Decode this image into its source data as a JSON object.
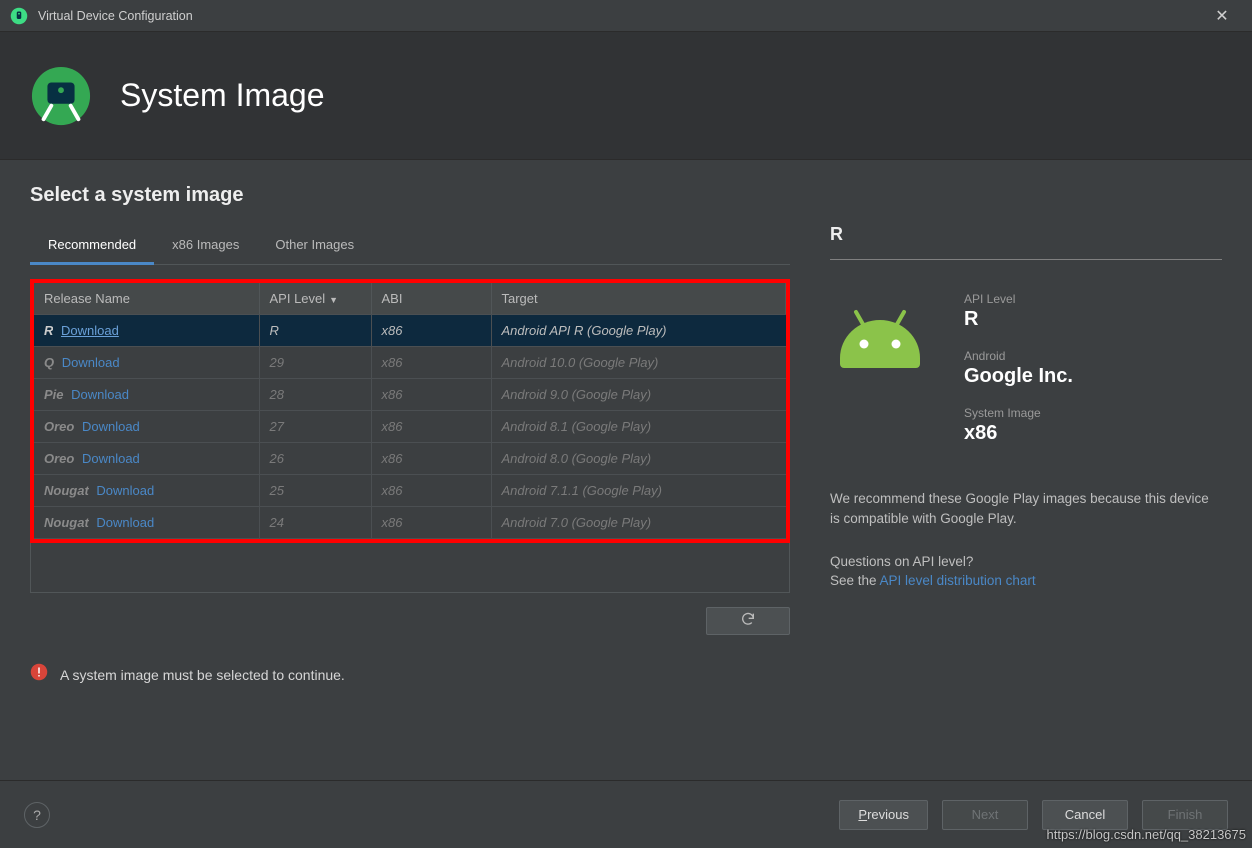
{
  "window": {
    "title": "Virtual Device Configuration"
  },
  "banner": {
    "title": "System Image"
  },
  "subtitle": "Select a system image",
  "tabs": [
    {
      "label": "Recommended",
      "active": true
    },
    {
      "label": "x86 Images",
      "active": false
    },
    {
      "label": "Other Images",
      "active": false
    }
  ],
  "columns": {
    "release": "Release Name",
    "api": "API Level",
    "abi": "ABI",
    "target": "Target"
  },
  "rows": [
    {
      "release": "R",
      "download": "Download",
      "api": "R",
      "abi": "x86",
      "target": "Android API R (Google Play)",
      "selected": true
    },
    {
      "release": "Q",
      "download": "Download",
      "api": "29",
      "abi": "x86",
      "target": "Android 10.0 (Google Play)"
    },
    {
      "release": "Pie",
      "download": "Download",
      "api": "28",
      "abi": "x86",
      "target": "Android 9.0 (Google Play)"
    },
    {
      "release": "Oreo",
      "download": "Download",
      "api": "27",
      "abi": "x86",
      "target": "Android 8.1 (Google Play)"
    },
    {
      "release": "Oreo",
      "download": "Download",
      "api": "26",
      "abi": "x86",
      "target": "Android 8.0 (Google Play)"
    },
    {
      "release": "Nougat",
      "download": "Download",
      "api": "25",
      "abi": "x86",
      "target": "Android 7.1.1 (Google Play)"
    },
    {
      "release": "Nougat",
      "download": "Download",
      "api": "24",
      "abi": "x86",
      "target": "Android 7.0 (Google Play)"
    }
  ],
  "error": "A system image must be selected to continue.",
  "detail": {
    "name": "R",
    "api_label": "API Level",
    "api_value": "R",
    "vendor_label": "Android",
    "vendor_value": "Google Inc.",
    "sys_label": "System Image",
    "sys_value": "x86",
    "recommend": "We recommend these Google Play images because this device is compatible with Google Play.",
    "question": "Questions on API level?",
    "see": "See the ",
    "link": "API level distribution chart"
  },
  "footer": {
    "previous": "Previous",
    "next": "Next",
    "cancel": "Cancel",
    "finish": "Finish"
  },
  "watermark": "https://blog.csdn.net/qq_38213675",
  "rname_widths": [
    "10px",
    "14px",
    "22px",
    "32px",
    "32px",
    "50px",
    "50px"
  ]
}
